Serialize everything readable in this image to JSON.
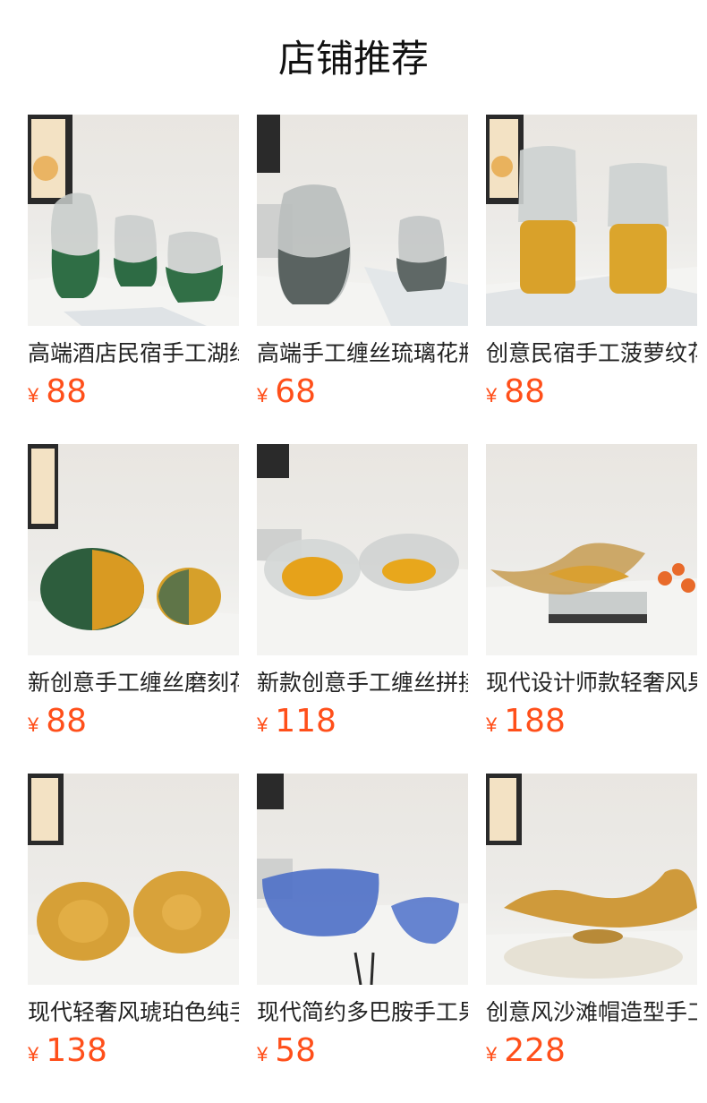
{
  "page": {
    "title": "店铺推荐"
  },
  "colors": {
    "price": "#ff4f1a",
    "text": "#222222",
    "background": "#ffffff"
  },
  "products": [
    {
      "name": "高端酒店民宿手工湖绿色缠丝花瓶",
      "currency": "¥",
      "price": "88",
      "color": "#2f6e45",
      "image": "green-wave-vases-photo"
    },
    {
      "name": "高端手工缠丝琉璃花瓶",
      "currency": "¥",
      "price": "68",
      "color": "#6f7a78",
      "image": "smoky-grey-vases-photo"
    },
    {
      "name": "创意民宿手工菠萝纹花瓶",
      "currency": "¥",
      "price": "88",
      "color": "#d9a12a",
      "image": "amber-pineapple-vases-photo"
    },
    {
      "name": "新创意手工缠丝磨刻花瓶",
      "currency": "¥",
      "price": "88",
      "color": "#2d5d3d",
      "image": "round-green-amber-vases-photo"
    },
    {
      "name": "新款创意手工缠丝拼接果盘",
      "currency": "¥",
      "price": "118",
      "color": "#e6a21a",
      "image": "amber-glass-bowls-photo"
    },
    {
      "name": "现代设计师款轻奢风果盘",
      "currency": "¥",
      "price": "188",
      "color": "#c9a15a",
      "image": "sculptural-glass-tray-photo"
    },
    {
      "name": "现代轻奢风琥珀色纯手工果盘",
      "currency": "¥",
      "price": "138",
      "color": "#d6a037",
      "image": "amber-hammered-bowls-photo"
    },
    {
      "name": "现代简约多巴胺手工果盘",
      "currency": "¥",
      "price": "58",
      "color": "#4d6fc6",
      "image": "blue-glass-bowls-photo"
    },
    {
      "name": "创意风沙滩帽造型手工果盘",
      "currency": "¥",
      "price": "228",
      "color": "#cf9a3b",
      "image": "amber-hat-shaped-bowl-photo"
    }
  ]
}
